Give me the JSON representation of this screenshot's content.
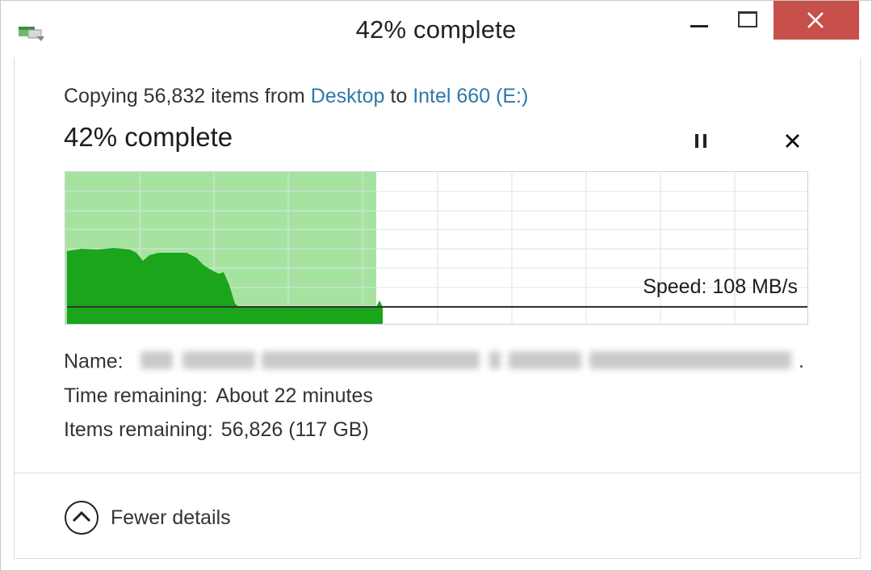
{
  "window": {
    "title": "42% complete"
  },
  "status": {
    "copy_prefix": "Copying 56,832 items from",
    "source": "Desktop",
    "to_word": "to",
    "destination": "Intel 660 (E:)",
    "progress_label": "42% complete",
    "progress_fraction": 0.42
  },
  "graph": {
    "speed_label": "Speed: 108 MB/s",
    "fill_color": "#a6e3a0",
    "area_color": "#1aa51a"
  },
  "details": {
    "name_label": "Name:",
    "name_suffix": ".",
    "time_label": "Time remaining:",
    "time_value": "About 22 minutes",
    "items_label": "Items remaining:",
    "items_value": "56,826 (117 GB)"
  },
  "footer": {
    "fewer_details_label": "Fewer details"
  },
  "icons": {
    "app": "file-copy-icon",
    "pause": "pause-icon",
    "cancel": "close-icon",
    "toggle": "chevron-up-circle-icon"
  }
}
